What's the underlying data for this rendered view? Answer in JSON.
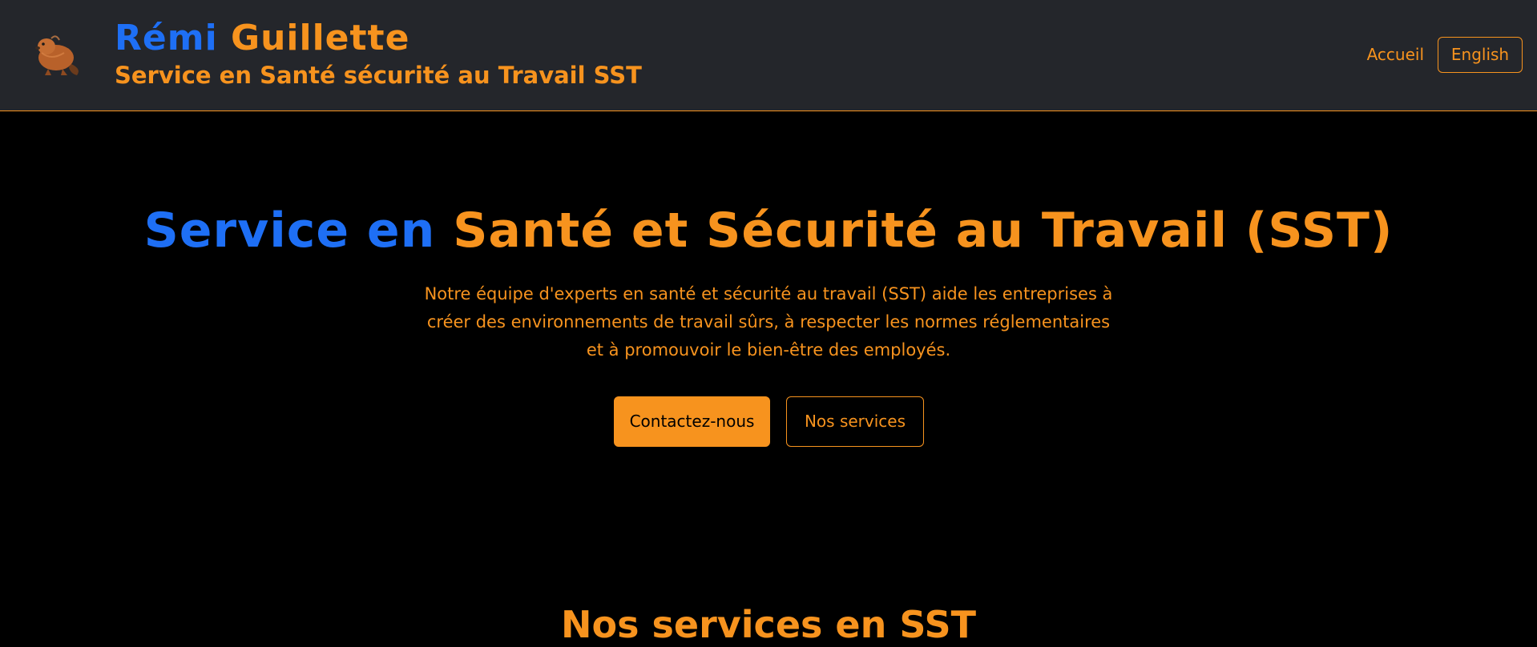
{
  "header": {
    "brand_first": "Rémi",
    "brand_last": "Guillette",
    "subtitle": "Service en Santé sécurité au Travail SST",
    "logo_icon": "beaver-logo-icon",
    "nav": {
      "home_label": "Accueil",
      "language_label": "English"
    }
  },
  "hero": {
    "title_blue": "Service en",
    "title_orange": "Santé et Sécurité au Travail (SST)",
    "description": "Notre équipe d'experts en santé et sécurité au travail (SST) aide les entreprises à créer des environnements de travail sûrs, à respecter les normes réglementaires et à promouvoir le bien-être des employés.",
    "primary_button": "Contactez-nous",
    "secondary_button": "Nos services"
  },
  "services": {
    "title": "Nos services en SST"
  },
  "colors": {
    "accent_orange": "#f7931e",
    "accent_blue": "#1e6ff5",
    "header_bg": "#24262b",
    "page_bg": "#000000"
  }
}
